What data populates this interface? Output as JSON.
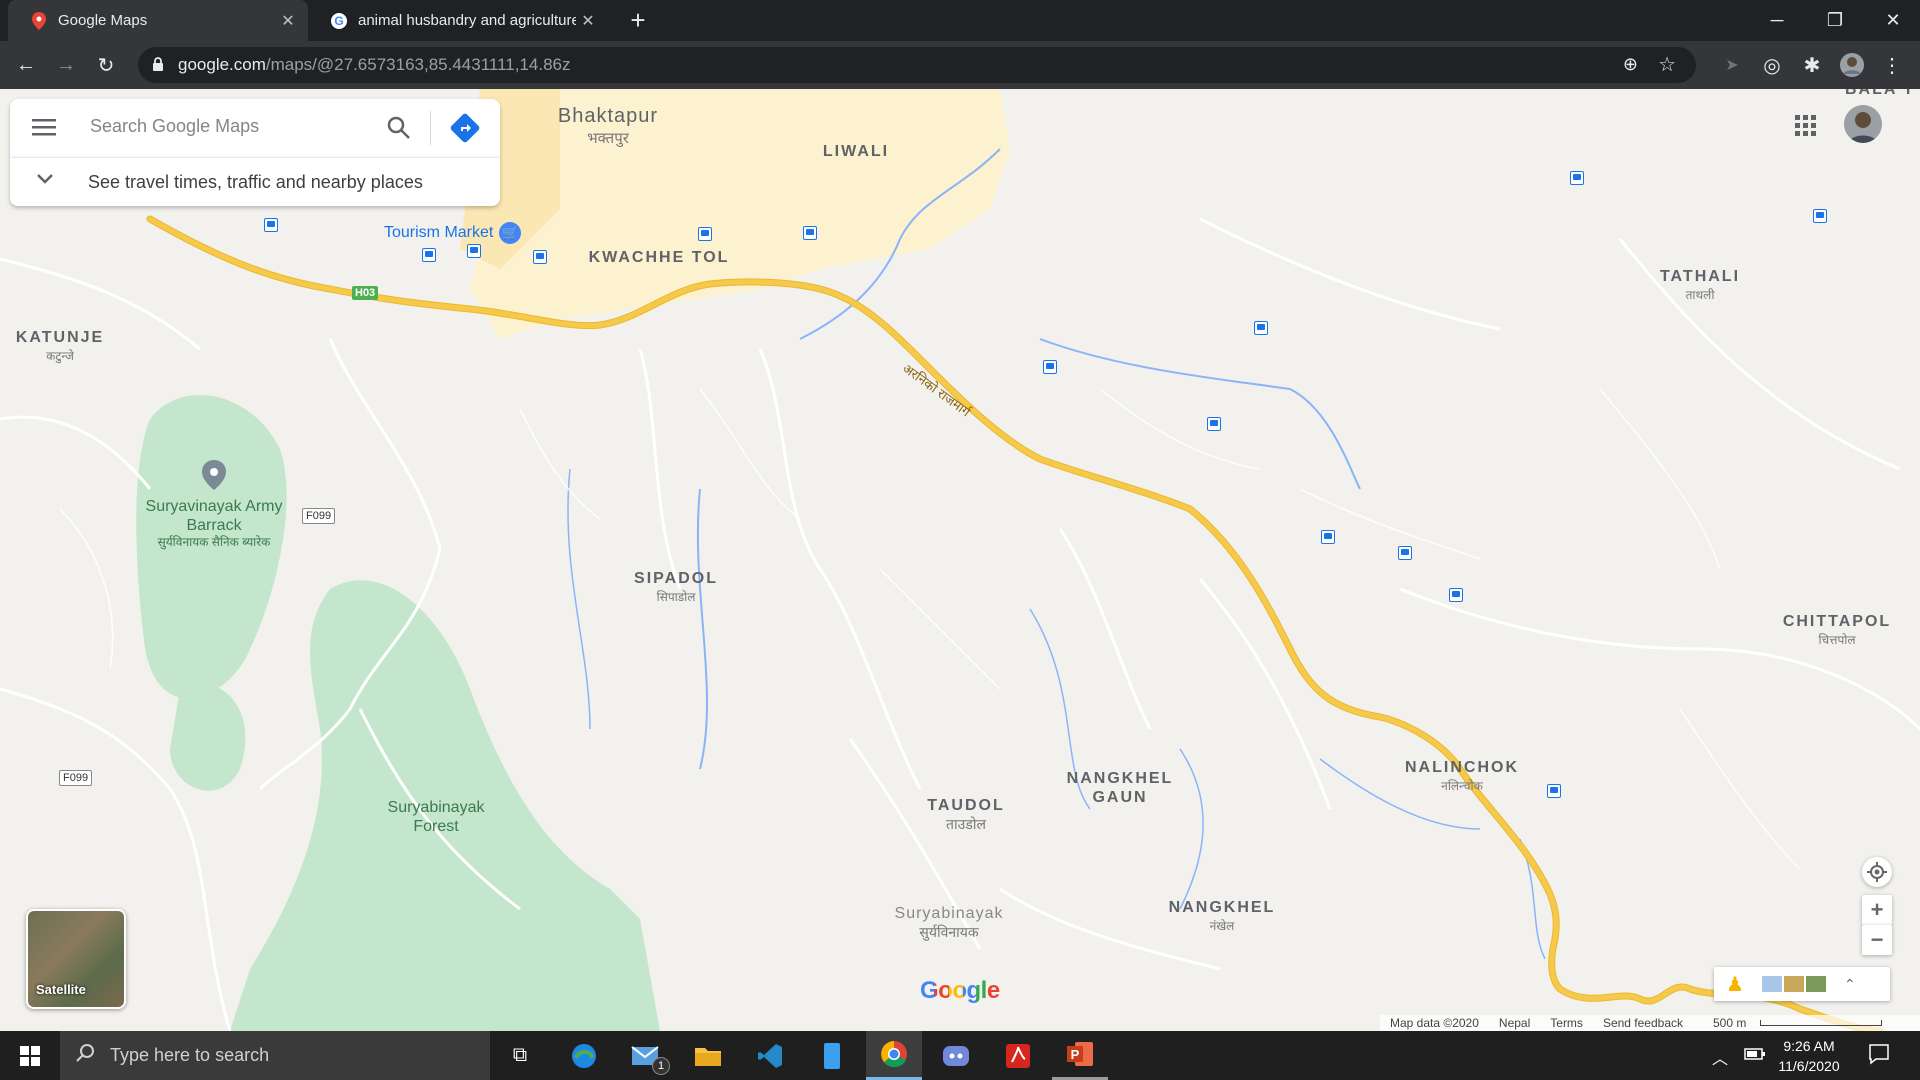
{
  "browser": {
    "tabs": [
      {
        "title": "Google Maps",
        "favicon": "google-maps-pin-icon",
        "active": true
      },
      {
        "title": "animal husbandry and agriculture",
        "favicon": "google-g-icon",
        "active": false
      }
    ],
    "url_host": "google.com",
    "url_path": "/maps/@27.6573163,85.4431111,14.86z"
  },
  "search": {
    "placeholder": "Search Google Maps",
    "travel_text": "See travel times, traffic and nearby places"
  },
  "map": {
    "places": [
      {
        "name": "KATUNJE",
        "sub": "कटुन्जे"
      },
      {
        "name": "KWACHHE TOL",
        "sub": ""
      },
      {
        "name": "LIWALI",
        "sub": ""
      },
      {
        "name": "TATHALI",
        "sub": "ताथली"
      },
      {
        "name": "SIPADOL",
        "sub": "सिपाडोल"
      },
      {
        "name": "CHITTAPOL",
        "sub": "चित्तपोल"
      },
      {
        "name": "NALINCHOK",
        "sub": "नलिन्चोक"
      },
      {
        "name": "NANGKHEL GAUN",
        "sub": ""
      },
      {
        "name": "TAUDOL",
        "sub": "ताउडोल"
      },
      {
        "name": "NANGKHEL",
        "sub": "नंखेल"
      },
      {
        "name": "BALA T",
        "sub": ""
      }
    ],
    "towns": [
      {
        "name": "Bhaktapur",
        "sub": "भक्तपुर"
      },
      {
        "name": "Suryabinayak",
        "sub": "सुर्यविनायक"
      }
    ],
    "poi": {
      "tourism_market": "Tourism Market",
      "army_barrack": "Suryavinayak Army Barrack",
      "army_barrack_sub": "सुर्यविनायक सैनिक ब्यारेक",
      "forest": "Suryabinayak Forest"
    },
    "road_label": "अरनिको राजमार्ग",
    "road_signs": {
      "h03": "H03",
      "f099_a": "F099",
      "f099_b": "F099"
    },
    "satellite_label": "Satellite",
    "google_logo": "Google",
    "footer": {
      "map_data": "Map data ©2020",
      "country": "Nepal",
      "terms": "Terms",
      "feedback": "Send feedback",
      "scale": "500 m"
    },
    "colors": {
      "highway": "#f6c94a",
      "park": "#c4e6cc",
      "water": "#8ab4f8",
      "urban": "#fdf2cf"
    }
  },
  "taskbar": {
    "search_placeholder": "Type here to search",
    "mail_badge": "1",
    "time": "9:26 AM",
    "date": "11/6/2020"
  }
}
